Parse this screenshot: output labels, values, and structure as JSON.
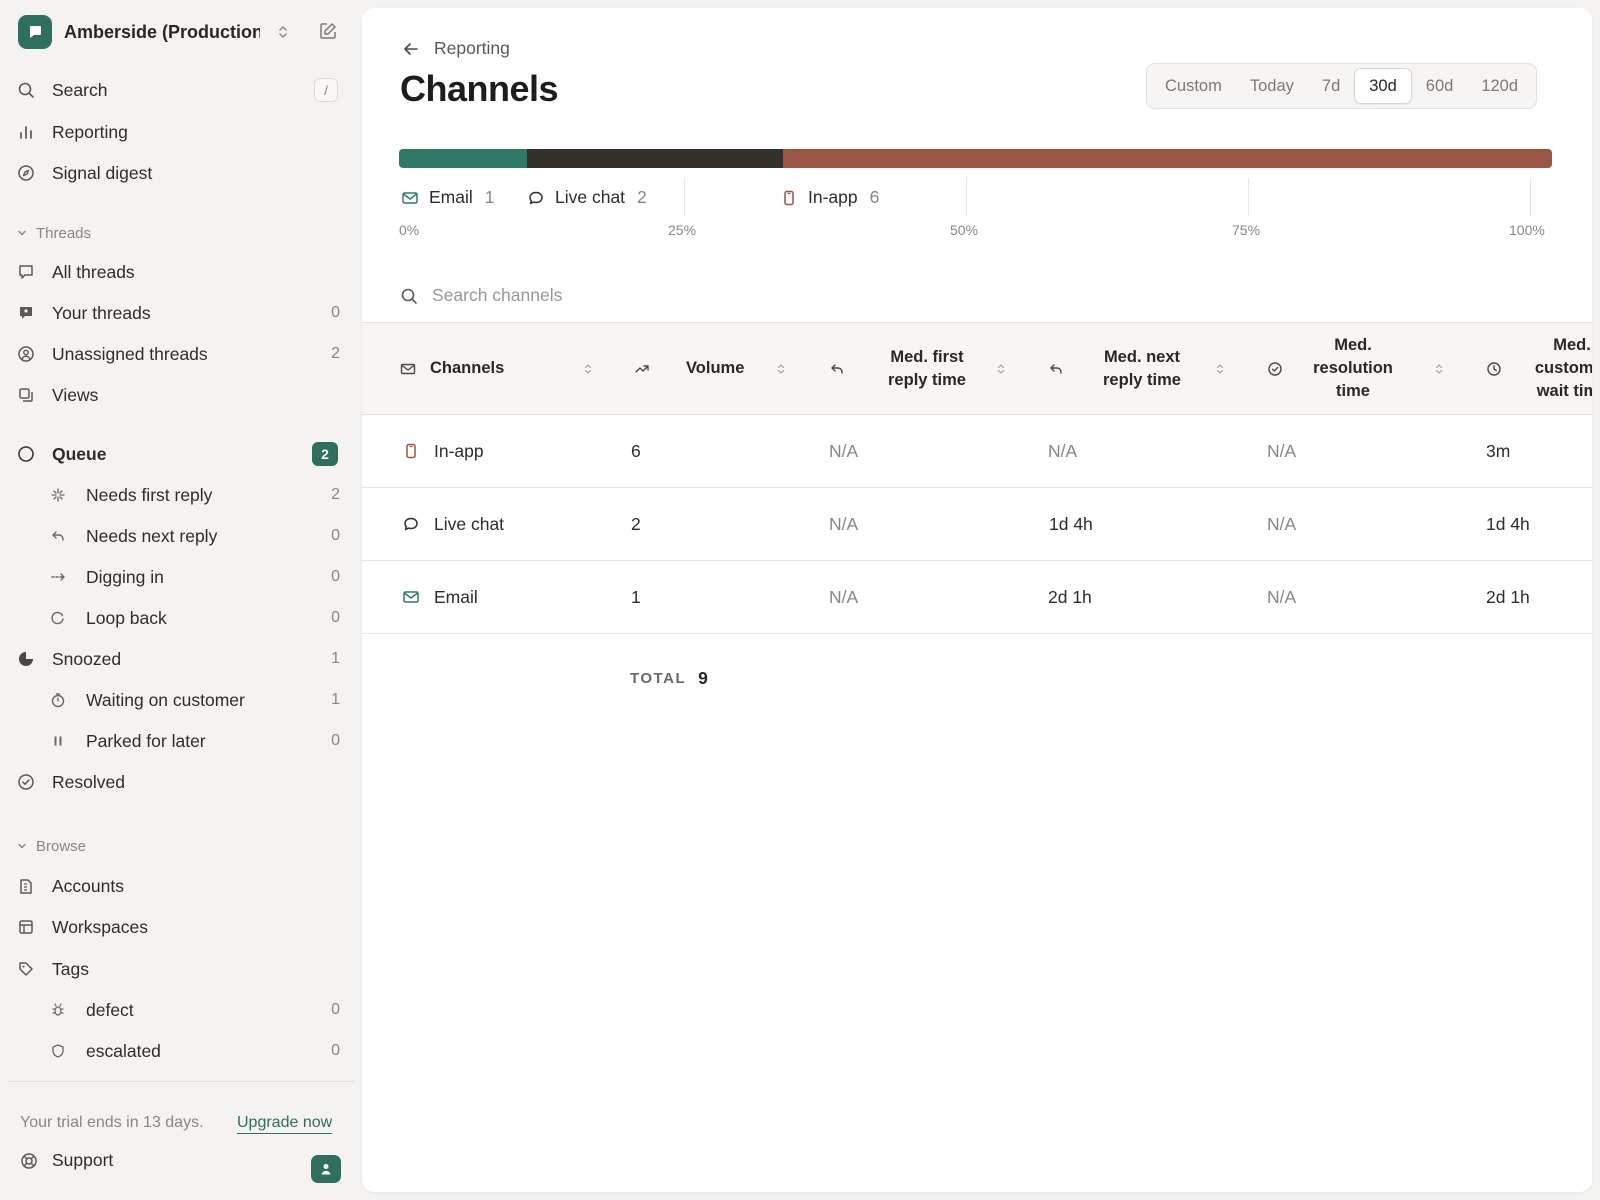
{
  "workspace": {
    "name": "Amberside (Production)"
  },
  "sidebar": {
    "search_label": "Search",
    "search_shortcut": "/",
    "reporting_label": "Reporting",
    "signal_digest_label": "Signal digest",
    "threads_header": "Threads",
    "threads": [
      {
        "label": "All threads",
        "count": ""
      },
      {
        "label": "Your threads",
        "count": "0"
      },
      {
        "label": "Unassigned threads",
        "count": "2"
      },
      {
        "label": "Views",
        "count": ""
      }
    ],
    "queue": {
      "label": "Queue",
      "badge": "2",
      "items": [
        {
          "label": "Needs first reply",
          "count": "2"
        },
        {
          "label": "Needs next reply",
          "count": "0"
        },
        {
          "label": "Digging in",
          "count": "0"
        },
        {
          "label": "Loop back",
          "count": "0"
        }
      ]
    },
    "snoozed": {
      "label": "Snoozed",
      "count": "1",
      "items": [
        {
          "label": "Waiting on customer",
          "count": "1"
        },
        {
          "label": "Parked for later",
          "count": "0"
        }
      ]
    },
    "resolved_label": "Resolved",
    "browse_header": "Browse",
    "browse": [
      {
        "label": "Accounts"
      },
      {
        "label": "Workspaces"
      },
      {
        "label": "Tags"
      }
    ],
    "tags": [
      {
        "label": "defect",
        "count": "0"
      },
      {
        "label": "escalated",
        "count": "0"
      }
    ],
    "trial_text": "Your trial ends in 13 days.",
    "upgrade_label": "Upgrade now",
    "support_label": "Support"
  },
  "page": {
    "breadcrumb": "Reporting",
    "title": "Channels",
    "ranges": [
      "Custom",
      "Today",
      "7d",
      "30d",
      "60d",
      "120d"
    ],
    "active_range": "30d",
    "search_placeholder": "Search channels"
  },
  "colors": {
    "email": "#2f7a66",
    "live_chat": "#34302c",
    "in_app": "#9a5443",
    "accent": "#2f6f5e"
  },
  "chart_data": {
    "type": "bar",
    "orientation": "horizontal-stacked",
    "series": [
      {
        "name": "Email",
        "value": 1,
        "icon": "mail-icon"
      },
      {
        "name": "Live chat",
        "value": 2,
        "icon": "chat-bubble-icon"
      },
      {
        "name": "In-app",
        "value": 6,
        "icon": "phone-icon"
      }
    ],
    "ticks": [
      "0%",
      "25%",
      "50%",
      "75%",
      "100%"
    ],
    "xlim": [
      0,
      100
    ]
  },
  "table": {
    "columns": [
      {
        "label": "Channels",
        "icon": "mail-icon"
      },
      {
        "label": "Volume",
        "icon": "trending-up-icon"
      },
      {
        "label": "Med. first reply time",
        "icon": "reply-icon"
      },
      {
        "label": "Med. next reply time",
        "icon": "reply-icon"
      },
      {
        "label": "Med. resolution time",
        "icon": "check-circle-icon"
      },
      {
        "label": "Med. customer wait time",
        "icon": "clock-icon"
      }
    ],
    "rows": [
      {
        "channel": "In-app",
        "icon": "phone-icon",
        "volume": "6",
        "first_reply": "N/A",
        "next_reply": "N/A",
        "resolution": "N/A",
        "wait": "3m"
      },
      {
        "channel": "Live chat",
        "icon": "chat-bubble-icon",
        "volume": "2",
        "first_reply": "N/A",
        "next_reply": "1d 4h",
        "resolution": "N/A",
        "wait": "1d 4h"
      },
      {
        "channel": "Email",
        "icon": "mail-icon",
        "volume": "1",
        "first_reply": "N/A",
        "next_reply": "2d 1h",
        "resolution": "N/A",
        "wait": "2d 1h"
      }
    ],
    "total_label": "TOTAL",
    "total_value": "9"
  }
}
